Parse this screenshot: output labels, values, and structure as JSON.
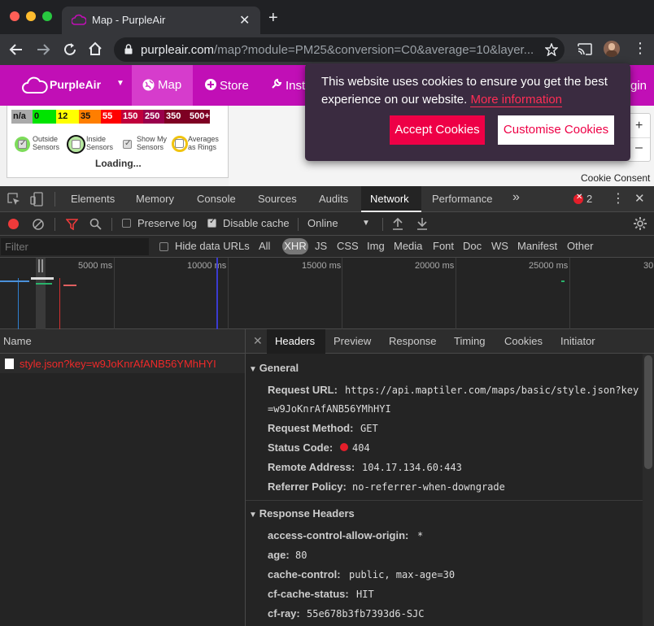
{
  "browser": {
    "tab_title": "Map - PurpleAir",
    "url_host": "purpleair.com",
    "url_path": "/map?module=PM25&conversion=C0&average=10&layer..."
  },
  "site": {
    "brand": "PurpleAir",
    "nav": {
      "map": "Map",
      "store": "Store",
      "install": "Insta",
      "login": "gin"
    },
    "scale": [
      "n/a",
      "0",
      "12",
      "35",
      "55",
      "150",
      "250",
      "350",
      "500+"
    ],
    "scale_colors": [
      "#aaaaaa",
      "#00e400",
      "#ffff00",
      "#ff7e00",
      "#ff0000",
      "#c0003c",
      "#99004c",
      "#7e0023",
      "#7e0023"
    ],
    "toggles": {
      "outside": [
        "Outside",
        "Sensors"
      ],
      "inside": [
        "Inside",
        "Sensors"
      ],
      "show_my": [
        "Show My",
        "Sensors"
      ],
      "averages": [
        "Averages",
        "as Rings"
      ]
    },
    "loading": "Loading...",
    "map_plus": "+",
    "map_minus": "–",
    "cookie_consent": "Cookie Consent"
  },
  "cookie": {
    "message": "This website uses cookies to ensure you get the best experience on our website.",
    "more": "More information",
    "accept": "Accept Cookies",
    "customise": "Customise Cookies"
  },
  "devtools": {
    "tabs": [
      "Elements",
      "Memory",
      "Console",
      "Sources",
      "Audits",
      "Network",
      "Performance"
    ],
    "more_tabs": "»",
    "error_count": "2",
    "preserve_log": "Preserve log",
    "disable_cache": "Disable cache",
    "throttle": "Online",
    "filter_placeholder": "Filter",
    "hide_data_urls": "Hide data URLs",
    "types": [
      "All",
      "XHR",
      "JS",
      "CSS",
      "Img",
      "Media",
      "Font",
      "Doc",
      "WS",
      "Manifest",
      "Other"
    ],
    "timeline_ticks": [
      "5000 ms",
      "10000 ms",
      "15000 ms",
      "20000 ms",
      "25000 ms",
      "30"
    ],
    "name_header": "Name",
    "request_name": "style.json?key=w9JoKnrAfANB56YMhHYI",
    "detail_tabs": [
      "Headers",
      "Preview",
      "Response",
      "Timing",
      "Cookies",
      "Initiator"
    ],
    "general_title": "General",
    "general": {
      "request_url_key": "Request URL:",
      "request_url_1": "https://api.maptiler.com/maps/basic/style.json?key",
      "request_url_2": "=w9JoKnrAfANB56YMhHYI",
      "method_key": "Request Method:",
      "method": "GET",
      "status_key": "Status Code:",
      "status": "404",
      "remote_key": "Remote Address:",
      "remote": "104.17.134.60:443",
      "referrer_key": "Referrer Policy:",
      "referrer": "no-referrer-when-downgrade"
    },
    "response_title": "Response Headers",
    "response_headers": [
      {
        "k": "access-control-allow-origin:",
        "v": "*"
      },
      {
        "k": "age:",
        "v": "80"
      },
      {
        "k": "cache-control:",
        "v": "public, max-age=30"
      },
      {
        "k": "cf-cache-status:",
        "v": "HIT"
      },
      {
        "k": "cf-ray:",
        "v": "55e678b3fb7393d6-SJC"
      }
    ]
  }
}
